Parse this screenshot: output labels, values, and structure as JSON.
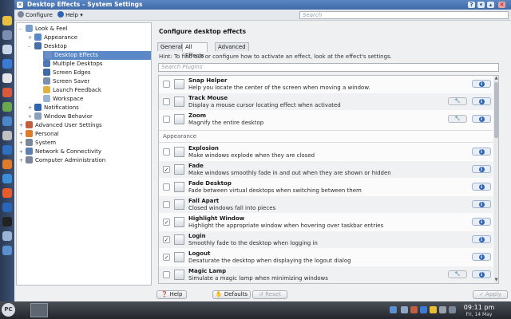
{
  "window": {
    "title": "Desktop Effects – System Settings"
  },
  "toolbar": {
    "configure_label": "Configure",
    "help_label": "Help",
    "search_placeholder": "Search"
  },
  "tree": {
    "items": [
      {
        "label": "Look & Feel",
        "level": 0,
        "expander": "–",
        "selected": false
      },
      {
        "label": "Appearance",
        "level": 1,
        "expander": "+",
        "selected": false
      },
      {
        "label": "Desktop",
        "level": 1,
        "expander": "–",
        "selected": false
      },
      {
        "label": "Desktop Effects",
        "level": 2,
        "expander": "",
        "selected": true
      },
      {
        "label": "Multiple Desktops",
        "level": 2,
        "expander": "",
        "selected": false
      },
      {
        "label": "Screen Edges",
        "level": 2,
        "expander": "",
        "selected": false
      },
      {
        "label": "Screen Saver",
        "level": 2,
        "expander": "",
        "selected": false
      },
      {
        "label": "Launch Feedback",
        "level": 2,
        "expander": "",
        "selected": false
      },
      {
        "label": "Workspace",
        "level": 2,
        "expander": "",
        "selected": false
      },
      {
        "label": "Notifications",
        "level": 1,
        "expander": "+",
        "selected": false
      },
      {
        "label": "Window Behavior",
        "level": 1,
        "expander": "+",
        "selected": false
      },
      {
        "label": "Advanced User Settings",
        "level": 0,
        "expander": "+",
        "selected": false
      },
      {
        "label": "Personal",
        "level": 0,
        "expander": "+",
        "selected": false
      },
      {
        "label": "System",
        "level": 0,
        "expander": "+",
        "selected": false
      },
      {
        "label": "Network & Connectivity",
        "level": 0,
        "expander": "+",
        "selected": false
      },
      {
        "label": "Computer Administration",
        "level": 0,
        "expander": "+",
        "selected": false
      }
    ]
  },
  "panel": {
    "title": "Configure desktop effects",
    "tabs": [
      "General",
      "All Effects",
      "Advanced"
    ],
    "active_tab": 1,
    "hint": "Hint: To find out or configure how to activate an effect, look at the effect's settings.",
    "plugin_search_placeholder": "Search Plugins"
  },
  "effects": [
    {
      "name": "Snap Helper",
      "desc": "Help you locate the center of the screen when moving a window.",
      "checked": false,
      "configurable": false
    },
    {
      "name": "Track Mouse",
      "desc": "Display a mouse cursor locating effect when activated",
      "checked": false,
      "configurable": true
    },
    {
      "name": "Zoom",
      "desc": "Magnify the entire desktop",
      "checked": false,
      "configurable": true
    },
    {
      "category": "Appearance"
    },
    {
      "name": "Explosion",
      "desc": "Make windows explode when they are closed",
      "checked": false,
      "configurable": false
    },
    {
      "name": "Fade",
      "desc": "Make windows smoothly fade in and out when they are shown or hidden",
      "checked": true,
      "configurable": false
    },
    {
      "name": "Fade Desktop",
      "desc": "Fade between virtual desktops when switching between them",
      "checked": false,
      "configurable": false
    },
    {
      "name": "Fall Apart",
      "desc": "Closed windows fall into pieces",
      "checked": false,
      "configurable": false
    },
    {
      "name": "Highlight Window",
      "desc": "Highlight the appropriate window when hovering over taskbar entries",
      "checked": true,
      "configurable": false
    },
    {
      "name": "Login",
      "desc": "Smoothly fade to the desktop when logging in",
      "checked": true,
      "configurable": false
    },
    {
      "name": "Logout",
      "desc": "Desaturate the desktop when displaying the logout dialog",
      "checked": true,
      "configurable": false
    },
    {
      "name": "Magic Lamp",
      "desc": "Simulate a magic lamp when minimizing windows",
      "checked": false,
      "configurable": true
    }
  ],
  "buttons": {
    "help": "Help",
    "defaults": "Defaults",
    "reset": "Reset",
    "apply": "Apply"
  },
  "clock": {
    "time": "09:11 pm",
    "date": "Fri, 14 May"
  },
  "colors": {
    "accent": "#5b89c7",
    "titlebar": "#4a78b8"
  }
}
